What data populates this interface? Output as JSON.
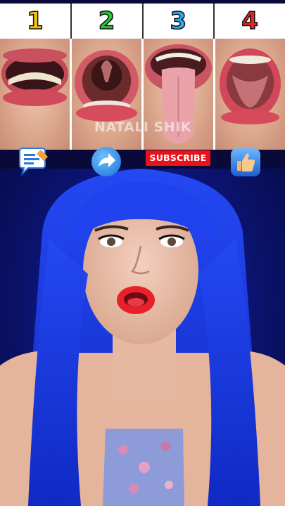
{
  "header": {
    "numbers": [
      {
        "label": "1",
        "color": "#f4c20d"
      },
      {
        "label": "2",
        "color": "#22c534"
      },
      {
        "label": "3",
        "color": "#29a8ec"
      },
      {
        "label": "4",
        "color": "#e52620"
      }
    ]
  },
  "photos": [
    {
      "icon": "open-mouth-teeth-photo"
    },
    {
      "icon": "open-mouth-throat-photo"
    },
    {
      "icon": "tongue-out-photo"
    },
    {
      "icon": "open-mouth-palate-photo"
    }
  ],
  "watermark": "NATALI SHIK",
  "actions": {
    "comment_icon": "comment-icon",
    "share_icon": "share-arrow-icon",
    "subscribe_label": "SUBSCRIBE",
    "subscribe_color": "#e8121b",
    "like_icon": "thumbs-up-icon"
  },
  "colors": {
    "background": "#0a0a3a",
    "wig": "#1636e0",
    "lips": "#e8202a"
  }
}
